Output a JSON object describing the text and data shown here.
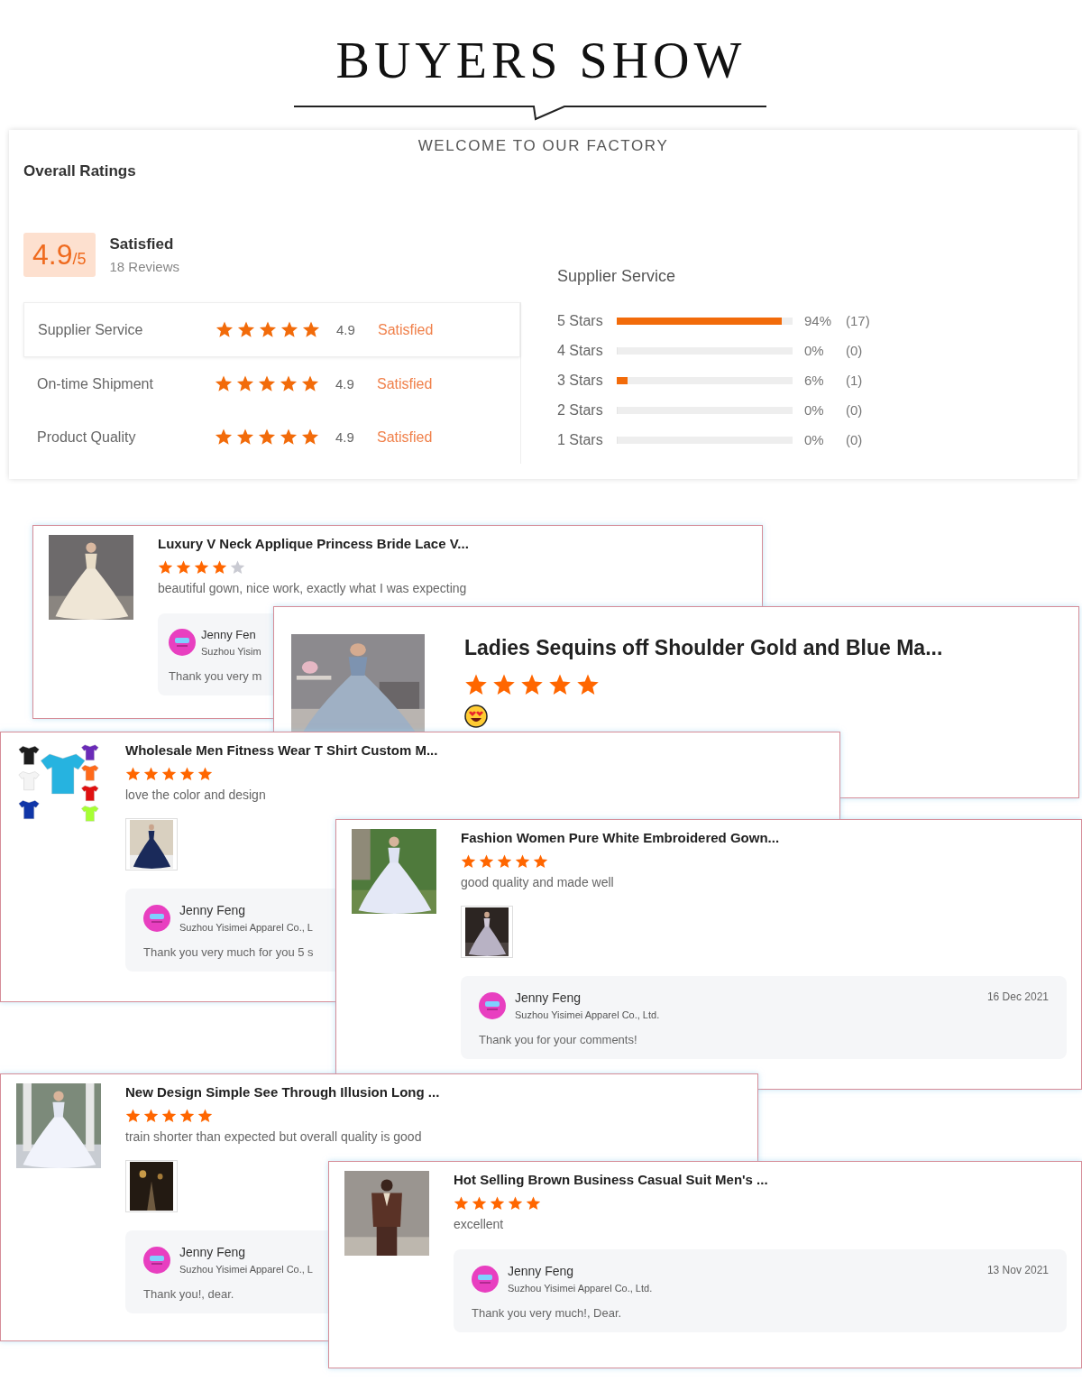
{
  "header": {
    "title": "BUYERS SHOW",
    "subtitle": "WELCOME TO OUR FACTORY"
  },
  "overall": {
    "heading": "Overall Ratings",
    "score": "4.9",
    "out_of": "/5",
    "verdict": "Satisfied",
    "reviews": "18 Reviews",
    "categories": [
      {
        "name": "Supplier Service",
        "stars": 5,
        "score": "4.9",
        "verdict": "Satisfied"
      },
      {
        "name": "On-time Shipment",
        "stars": 5,
        "score": "4.9",
        "verdict": "Satisfied"
      },
      {
        "name": "Product Quality",
        "stars": 5,
        "score": "4.9",
        "verdict": "Satisfied"
      }
    ],
    "breakdown": {
      "heading": "Supplier Service",
      "rows": [
        {
          "label": "5 Stars",
          "level": 0.94,
          "percent": "94%",
          "count": "(17)"
        },
        {
          "label": "4 Stars",
          "level": 0,
          "percent": "0%",
          "count": "(0)"
        },
        {
          "label": "3 Stars",
          "level": 0.06,
          "percent": "6%",
          "count": "(1)"
        },
        {
          "label": "2 Stars",
          "level": 0,
          "percent": "0%",
          "count": "(0)"
        },
        {
          "label": "1 Stars",
          "level": 0,
          "percent": "0%",
          "count": "(0)"
        }
      ]
    }
  },
  "reviews": [
    {
      "title": "Luxury V Neck Applique Princess Bride Lace V...",
      "stars": 4,
      "comment": "beautiful gown, nice work, exactly what I was expecting",
      "reply": {
        "name": "Jenny Fen",
        "company": "Suzhou Yisim",
        "message": "Thank you very m"
      }
    },
    {
      "title": "Ladies Sequins off Shoulder Gold and Blue Ma...",
      "stars": 5,
      "emoji_reaction": true
    },
    {
      "title": "Wholesale Men Fitness Wear T Shirt Custom M...",
      "stars": 5,
      "comment": "love the color and design",
      "reply": {
        "name": "Jenny Feng",
        "company": "Suzhou Yisimei Apparel Co., L",
        "message": "Thank you very much for you 5 s"
      }
    },
    {
      "title": "Fashion Women Pure White Embroidered Gown...",
      "stars": 5,
      "comment": "good quality and made well",
      "reply": {
        "name": "Jenny Feng",
        "company": "Suzhou Yisimei Apparel Co., Ltd.",
        "date": "16 Dec 2021",
        "message": "Thank you for your comments!"
      }
    },
    {
      "title": "New Design Simple See Through Illusion Long ...",
      "stars": 5,
      "comment": "train shorter than expected but overall quality is good",
      "reply": {
        "name": "Jenny Feng",
        "company": "Suzhou Yisimei Apparel Co., L",
        "message": "Thank you!, dear."
      }
    },
    {
      "title": "Hot Selling Brown Business Casual Suit Men's ...",
      "stars": 5,
      "comment": "excellent",
      "reply": {
        "name": "Jenny Feng",
        "company": "Suzhou Yisimei Apparel Co., Ltd.",
        "date": "13 Nov 2021",
        "message": "Thank you very much!, Dear."
      }
    }
  ]
}
